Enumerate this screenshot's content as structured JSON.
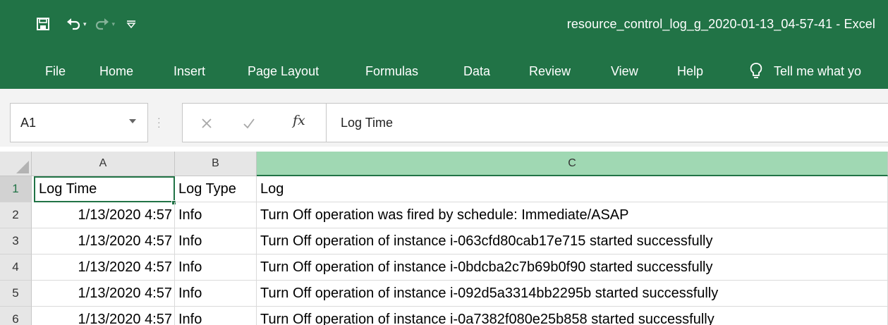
{
  "window": {
    "title": "resource_control_log_g_2020-01-13_04-57-41  -  Excel"
  },
  "quick_access": {
    "save_icon": "save-icon",
    "undo_icon": "undo-icon",
    "redo_icon": "redo-icon",
    "customize_icon": "customize-qat-icon"
  },
  "ribbon": {
    "tabs": [
      {
        "label": "File"
      },
      {
        "label": "Home"
      },
      {
        "label": "Insert"
      },
      {
        "label": "Page Layout"
      },
      {
        "label": "Formulas"
      },
      {
        "label": "Data"
      },
      {
        "label": "Review"
      },
      {
        "label": "View"
      },
      {
        "label": "Help"
      }
    ],
    "tell_me": {
      "icon": "lightbulb-icon",
      "label": "Tell me what yo"
    }
  },
  "formula_bar": {
    "name_box": "A1",
    "cancel_icon": "close-icon",
    "enter_icon": "check-icon",
    "fx_label": "fx",
    "value": "Log Time"
  },
  "sheet": {
    "columns": [
      "A",
      "B",
      "C"
    ],
    "selected_column": "C",
    "active_cell": "A1",
    "rows": [
      {
        "num": "1",
        "cells": [
          "Log Time",
          "Log Type",
          "Log"
        ]
      },
      {
        "num": "2",
        "cells": [
          "1/13/2020 4:57",
          "Info",
          "Turn Off operation was fired by schedule: Immediate/ASAP"
        ]
      },
      {
        "num": "3",
        "cells": [
          "1/13/2020 4:57",
          "Info",
          "Turn Off operation of instance i-063cfd80cab17e715 started successfully"
        ]
      },
      {
        "num": "4",
        "cells": [
          "1/13/2020 4:57",
          "Info",
          "Turn Off operation of instance i-0bdcba2c7b69b0f90 started successfully"
        ]
      },
      {
        "num": "5",
        "cells": [
          "1/13/2020 4:57",
          "Info",
          "Turn Off operation of instance i-092d5a3314bb2295b started successfully"
        ]
      },
      {
        "num": "6",
        "cells": [
          "1/13/2020 4:57",
          "Info",
          "Turn Off operation of instance i-0a7382f080e25b858 started successfully"
        ]
      }
    ]
  },
  "colors": {
    "excel_green": "#217346",
    "selected_header": "#a0d8b3",
    "header_gray": "#e6e6e6"
  }
}
